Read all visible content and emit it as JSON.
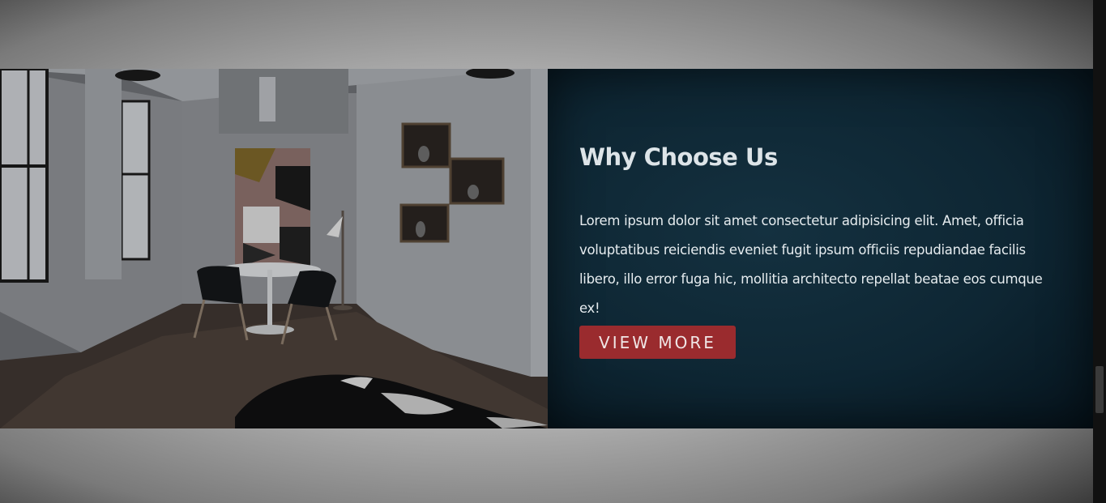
{
  "about": {
    "title": "Why Choose Us",
    "paragraph": "Lorem ipsum dolor sit amet consectetur adipisicing elit. Amet, officia voluptatibus reiciendis eveniet fugit ipsum officiis repudiandae facilis libero, illo error fuga hic, mollitia architecto repellat beatae eos cumque ex!",
    "button_label": "VIEW MORE"
  },
  "colors": {
    "panel_background": "#0e2633",
    "button": "#9a2b2e",
    "title_text": "#dde4e8"
  }
}
